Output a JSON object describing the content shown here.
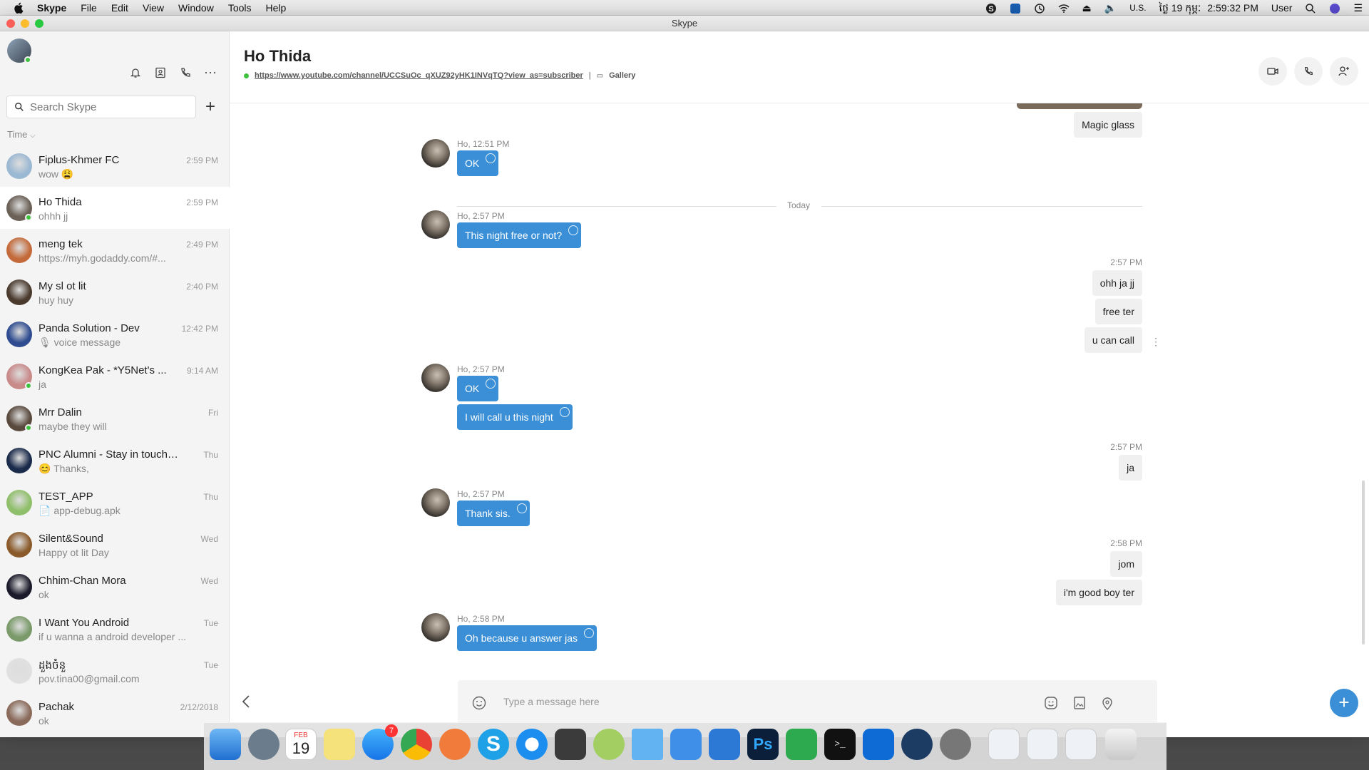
{
  "menubar": {
    "app": "Skype",
    "items": [
      "File",
      "Edit",
      "View",
      "Window",
      "Tools",
      "Help"
    ],
    "input_source": "U.S.",
    "date": "ថ្ងៃ 19 កុម្ភៈ",
    "time": "2:59:32 PM",
    "user": "User"
  },
  "window": {
    "title": "Skype"
  },
  "sidebar": {
    "search_placeholder": "Search Skype",
    "sort_label": "Time",
    "chats": [
      {
        "name": "Fiplus-Khmer FC",
        "preview": "wow 😩",
        "time": "2:59 PM",
        "color": "#9bb8d3",
        "online": false
      },
      {
        "name": "Ho Thida",
        "preview": "ohhh jj",
        "time": "2:59 PM",
        "color": "#6b6157",
        "online": true
      },
      {
        "name": "meng tek",
        "preview": "https://myh.godaddy.com/#...",
        "time": "2:49 PM",
        "color": "#c46a3a",
        "online": false
      },
      {
        "name": "My sl ot lit",
        "preview": "huy huy",
        "time": "2:40 PM",
        "color": "#4a3a2e",
        "online": false
      },
      {
        "name": "Panda Solution - Dev",
        "preview": "🎙 voice message",
        "time": "12:42 PM",
        "color": "#2e4c8f",
        "online": false
      },
      {
        "name": "KongKea Pak - *Y5Net's ...",
        "preview": "ja",
        "time": "9:14 AM",
        "color": "#c98a8a",
        "online": true
      },
      {
        "name": "Mrr Dalin",
        "preview": "maybe they will",
        "time": "Fri",
        "color": "#5a4a3e",
        "online": true
      },
      {
        "name": "PNC Alumni - Stay in touch to...",
        "preview": "😊 Thanks,",
        "time": "Thu",
        "color": "#1a2a4a",
        "online": false
      },
      {
        "name": "TEST_APP",
        "preview": "📄 app-debug.apk",
        "time": "Thu",
        "color": "#8fbf6a",
        "online": false
      },
      {
        "name": "Silent&Sound",
        "preview": "Happy ot lit Day",
        "time": "Wed",
        "color": "#8a5a2a",
        "online": false
      },
      {
        "name": "Chhim-Chan Mora",
        "preview": "ok",
        "time": "Wed",
        "color": "#1a1a2a",
        "online": false
      },
      {
        "name": "I Want You Android",
        "preview": "if u wanna a android developer ...",
        "time": "Tue",
        "color": "#7a9a6a",
        "online": false
      },
      {
        "name": "ដួងចំនួ",
        "preview": "pov.tina00@gmail.com",
        "time": "Tue",
        "color": "#e0e0e0",
        "online": false
      },
      {
        "name": "Pachak",
        "preview": "ok",
        "time": "2/12/2018",
        "color": "#8a6a5a",
        "online": false
      }
    ]
  },
  "conversation": {
    "name": "Ho Thida",
    "link": "https://www.youtube.com/channel/UCCSuOc_qXUZ92yHK1INVqTQ?view_as=subscriber",
    "gallery_label": "Gallery",
    "day_separator": "Today",
    "composer_placeholder": "Type a message here",
    "messages": {
      "out0": "Magic glass",
      "in1_meta": "Ho, 12:51 PM",
      "in1": "OK",
      "in2_meta": "Ho, 2:57 PM",
      "in2": "This night free or not?",
      "out1_meta": "2:57 PM",
      "out1a": "ohh ja jj",
      "out1b": "free ter",
      "out1c": "u can call",
      "in3_meta": "Ho, 2:57 PM",
      "in3a": "OK",
      "in3b": "I will call u this night",
      "out2_meta": "2:57 PM",
      "out2": "ja",
      "in4_meta": "Ho, 2:57 PM",
      "in4": "Thank sis.",
      "out3_meta": "2:58 PM",
      "out3a": "jom",
      "out3b": "i'm good boy ter",
      "in5_meta": "Ho, 2:58 PM",
      "in5": "Oh because u answer jas"
    }
  },
  "colors": {
    "accent": "#3a8fd6",
    "online": "#3ec23e"
  },
  "dock": {
    "calendar_month": "FEB",
    "calendar_day": "19",
    "appstore_badge": "7"
  }
}
